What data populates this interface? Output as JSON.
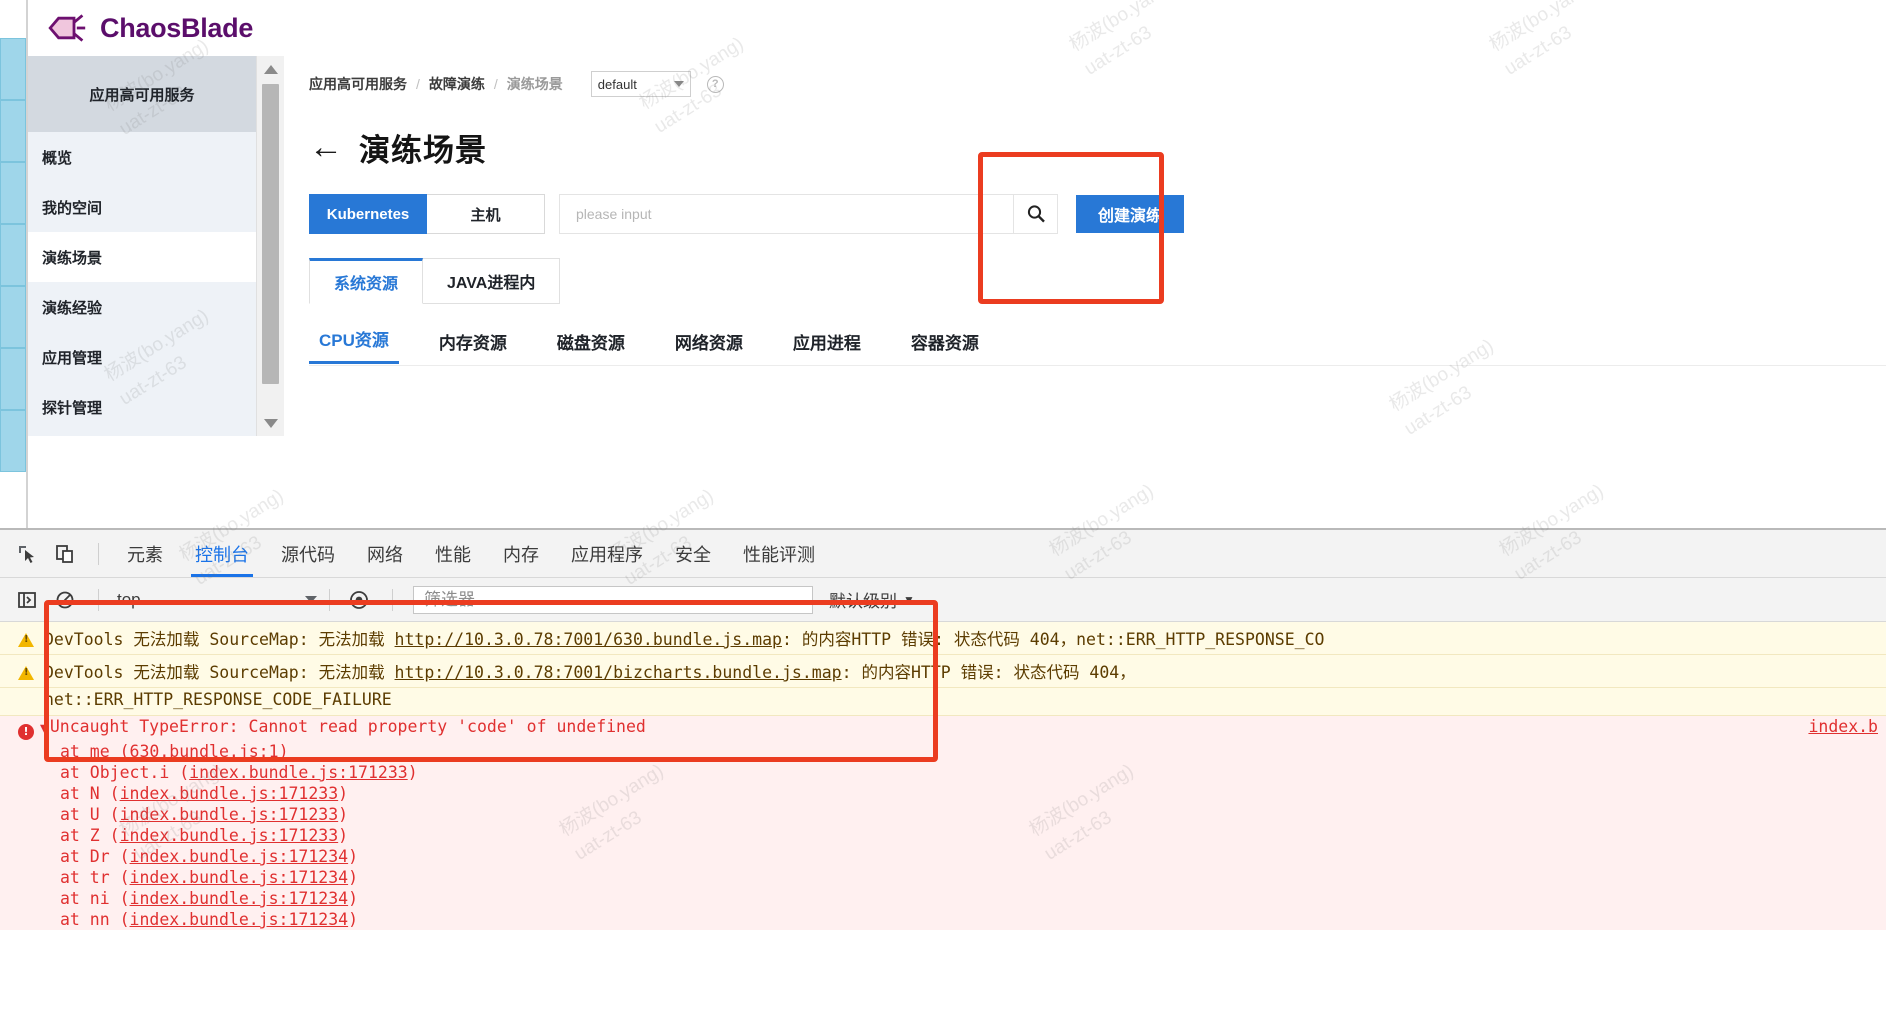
{
  "brand": {
    "name": "ChaosBlade",
    "logo_icon": "chaosblade-logo-icon"
  },
  "sidebar": {
    "header": "应用高可用服务",
    "items": [
      {
        "label": "概览",
        "active": false
      },
      {
        "label": "我的空间",
        "active": false
      },
      {
        "label": "演练场景",
        "active": true
      },
      {
        "label": "演练经验",
        "active": false
      },
      {
        "label": "应用管理",
        "active": false
      },
      {
        "label": "探针管理",
        "active": false
      }
    ],
    "scroll_up_icon": "triangle-up-icon",
    "scroll_down_icon": "triangle-down-icon"
  },
  "breadcrumb": {
    "items": [
      "应用高可用服务",
      "故障演练",
      "演练场景"
    ],
    "separator": "/",
    "namespace_value": "default",
    "namespace_chevron_icon": "chevron-down-icon",
    "help_icon": "question-mark-icon",
    "help_glyph": "?"
  },
  "page": {
    "back_icon": "back-arrow-icon",
    "back_glyph": "←",
    "title": "演练场景"
  },
  "toolbar": {
    "segments": [
      {
        "label": "Kubernetes",
        "selected": true
      },
      {
        "label": "主机",
        "selected": false
      }
    ],
    "search_placeholder": "please input",
    "search_value": "",
    "search_icon": "search-icon",
    "create_button": "创建演练"
  },
  "card_tabs": [
    {
      "label": "系统资源",
      "selected": true
    },
    {
      "label": "JAVA进程内",
      "selected": false
    }
  ],
  "sub_tabs": [
    {
      "label": "CPU资源",
      "selected": true
    },
    {
      "label": "内存资源",
      "selected": false
    },
    {
      "label": "磁盘资源",
      "selected": false
    },
    {
      "label": "网络资源",
      "selected": false
    },
    {
      "label": "应用进程",
      "selected": false
    },
    {
      "label": "容器资源",
      "selected": false
    }
  ],
  "devtools": {
    "inspect_icon": "inspect-element-icon",
    "device_icon": "device-toolbar-icon",
    "tabs": [
      {
        "label": "元素",
        "selected": false
      },
      {
        "label": "控制台",
        "selected": true
      },
      {
        "label": "源代码",
        "selected": false
      },
      {
        "label": "网络",
        "selected": false
      },
      {
        "label": "性能",
        "selected": false
      },
      {
        "label": "内存",
        "selected": false
      },
      {
        "label": "应用程序",
        "selected": false
      },
      {
        "label": "安全",
        "selected": false
      },
      {
        "label": "性能评测",
        "selected": false
      }
    ],
    "sidebar_toggle_icon": "console-sidebar-icon",
    "clear_icon": "clear-console-icon",
    "context_value": "top",
    "context_chevron_icon": "chevron-down-icon",
    "eye_icon": "live-expression-icon",
    "filter_placeholder": "筛选器",
    "filter_value": "",
    "level_label": "默认级别",
    "level_chevron": "▼"
  },
  "console": {
    "warnings": [
      {
        "icon": "warning-triangle-icon",
        "prefix": "DevTools 无法加载 SourceMap: 无法加载 ",
        "link": "http://10.3.0.78:7001/630.bundle.js.map",
        "suffix": ": 的内容HTTP 错误: 状态代码 404，net::ERR_HTTP_RESPONSE_CO"
      },
      {
        "icon": "warning-triangle-icon",
        "prefix": "DevTools 无法加载 SourceMap: 无法加载 ",
        "link": "http://10.3.0.78:7001/bizcharts.bundle.js.map",
        "suffix": ": 的内容HTTP 错误: 状态代码 404，",
        "continuation": "net::ERR_HTTP_RESPONSE_CODE_FAILURE"
      }
    ],
    "error": {
      "icon": "error-circle-icon",
      "disclosure": "▼",
      "message": "Uncaught TypeError: Cannot read property 'code' of undefined",
      "source_right": "index.b",
      "stack": [
        {
          "fn": "at me (",
          "link": "630.bundle.js:1",
          "close": ")"
        },
        {
          "fn": "at Object.i (",
          "link": "index.bundle.js:171233",
          "close": ")"
        },
        {
          "fn": "at N (",
          "link": "index.bundle.js:171233",
          "close": ")"
        },
        {
          "fn": "at U (",
          "link": "index.bundle.js:171233",
          "close": ")"
        },
        {
          "fn": "at Z (",
          "link": "index.bundle.js:171233",
          "close": ")"
        },
        {
          "fn": "at Dr (",
          "link": "index.bundle.js:171234",
          "close": ")"
        },
        {
          "fn": "at tr (",
          "link": "index.bundle.js:171234",
          "close": ")"
        },
        {
          "fn": "at ni (",
          "link": "index.bundle.js:171234",
          "close": ")"
        },
        {
          "fn": "at nn (",
          "link": "index.bundle.js:171234",
          "close": ")"
        }
      ]
    }
  },
  "annotations": [
    {
      "name": "create-button-highlight",
      "color": "#eb3c20"
    },
    {
      "name": "error-stack-highlight",
      "color": "#eb3c20"
    }
  ],
  "watermark": {
    "line1": "杨波(bo.yang)",
    "line2": "uat-zt-63"
  },
  "colors": {
    "primary": "#2878d6",
    "brand": "#5b0e6b",
    "annotation": "#eb3c20",
    "warn_bg": "#fffbe6",
    "error_bg": "#fff0f0",
    "error_text": "#e03030"
  }
}
